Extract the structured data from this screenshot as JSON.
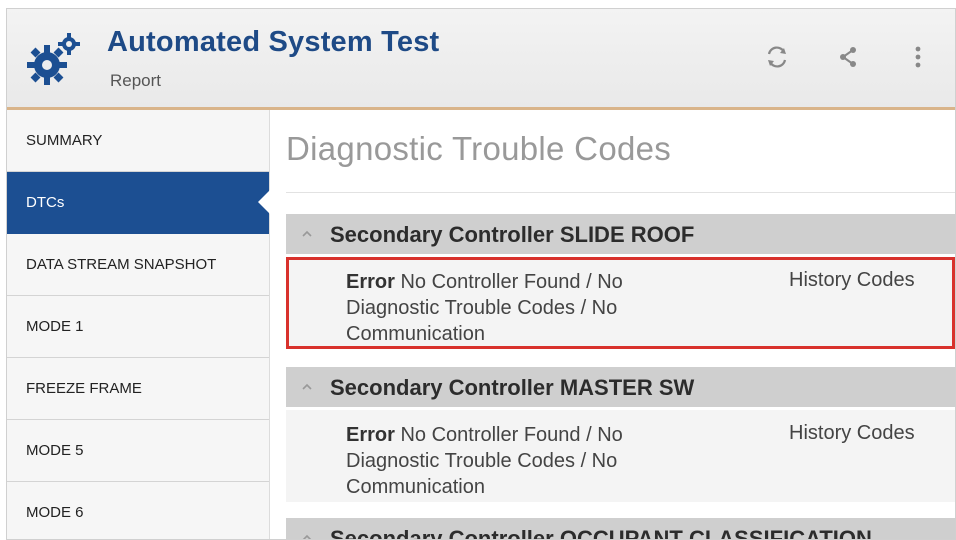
{
  "header": {
    "title": "Automated System Test",
    "subtitle": "Report",
    "icons": [
      "gears-icon",
      "refresh-icon",
      "share-icon",
      "more-vert-icon"
    ]
  },
  "sidebar": {
    "items": [
      {
        "label": "SUMMARY",
        "active": false
      },
      {
        "label": "DTCs",
        "active": true
      },
      {
        "label": "DATA STREAM SNAPSHOT",
        "active": false
      },
      {
        "label": "MODE 1",
        "active": false
      },
      {
        "label": "FREEZE FRAME",
        "active": false
      },
      {
        "label": "MODE 5",
        "active": false
      },
      {
        "label": "MODE 6",
        "active": false
      }
    ]
  },
  "main": {
    "title": "Diagnostic Trouble Codes",
    "sections": [
      {
        "title": "Secondary Controller SLIDE ROOF",
        "row": {
          "severity": "Error",
          "message": " No Controller Found / No Diagnostic Trouble Codes / No Communication",
          "type": "History Codes"
        }
      },
      {
        "title": "Secondary Controller MASTER SW",
        "row": {
          "severity": "Error",
          "message": " No Controller Found / No Diagnostic Trouble Codes / No Communication",
          "type": "History Codes"
        }
      },
      {
        "title": "Secondary Controller OCCUPANT CLASSIFICATION"
      }
    ]
  },
  "colors": {
    "title": "#1e4a86",
    "active_item": "#1c4f92",
    "highlight": "#d8312c",
    "section_header": "#cfcfcf"
  }
}
